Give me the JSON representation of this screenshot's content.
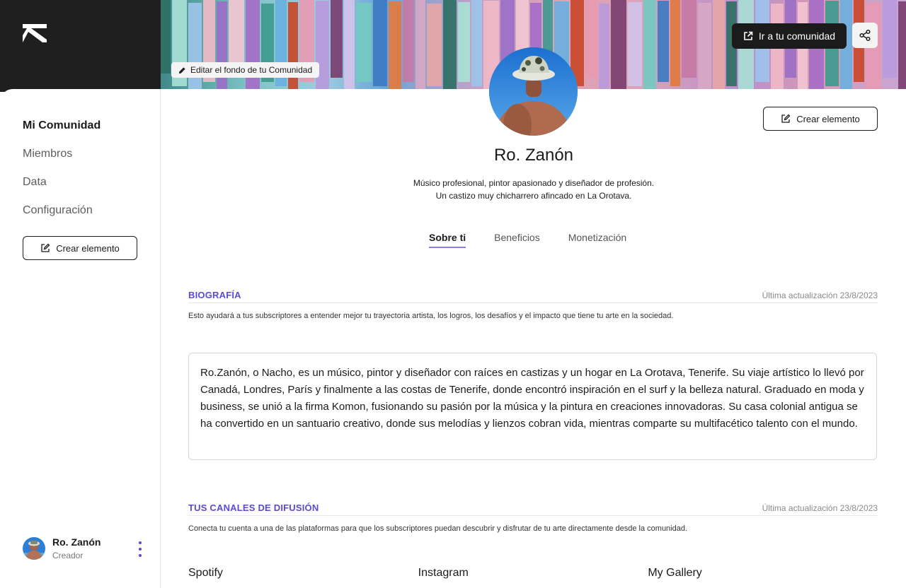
{
  "colors": {
    "accent": "#5b4bd1",
    "dark": "#1b1b1b",
    "border": "#d5d5d5",
    "muted": "#8a8a8a"
  },
  "header": {
    "edit_background_label": "Editar el fondo de tu Comunidad",
    "go_community_label": "Ir a tu comunidad",
    "share_icon": "share-icon",
    "logo": "brand-logo"
  },
  "sidebar": {
    "items": [
      {
        "label": "Mi Comunidad",
        "active": true
      },
      {
        "label": "Miembros",
        "active": false
      },
      {
        "label": "Data",
        "active": false
      },
      {
        "label": "Configuración",
        "active": false
      }
    ],
    "create_label": "Crear elemento",
    "user": {
      "name": "Ro. Zanón",
      "role": "Creador"
    }
  },
  "profile": {
    "name": "Ro. Zanón",
    "bio_line1": "Músico profesional, pintor apasionado y diseñador de profesión.",
    "bio_line2": "Un castizo muy chicharrero afincado en La Orotava.",
    "create_label": "Crear elemento"
  },
  "tabs": [
    {
      "label": "Sobre ti",
      "active": true
    },
    {
      "label": "Beneficios",
      "active": false
    },
    {
      "label": "Monetización",
      "active": false
    }
  ],
  "biography": {
    "title": "BIOGRAFÍA",
    "updated": "Última actualización 23/8/2023",
    "description": "Esto ayudará a tus subscriptores a entender mejor tu trayectoria artista, los logros, los desafíos y el impacto que tiene tu arte en la sociedad.",
    "text": "Ro.Zanón, o Nacho, es un músico, pintor y diseñador con raíces en castizas y un hogar en La Orotava, Tenerife. Su viaje artístico lo llevó por Canadá, Londres, París y finalmente a las costas de Tenerife, donde encontró inspiración en el surf y la belleza natural. Graduado en moda y business, se unió a la firma Komon, fusionando su pasión por la música y la pintura en creaciones innovadoras. Su casa colonial antigua se ha convertido en un santuario creativo, donde sus melodías y lienzos cobran vida, mientras comparte su multifacético talento con el mundo."
  },
  "channels_section": {
    "title": "TUS CANALES DE DIFUSIÓN",
    "updated": "Última actualización 23/8/2023",
    "description": "Conecta tu cuenta a una de las plataformas para que los subscriptores puedan descubrir y disfrutar de tu arte directamente desde la comunidad.",
    "channels": [
      "Spotify",
      "Instagram",
      "My Gallery"
    ]
  }
}
